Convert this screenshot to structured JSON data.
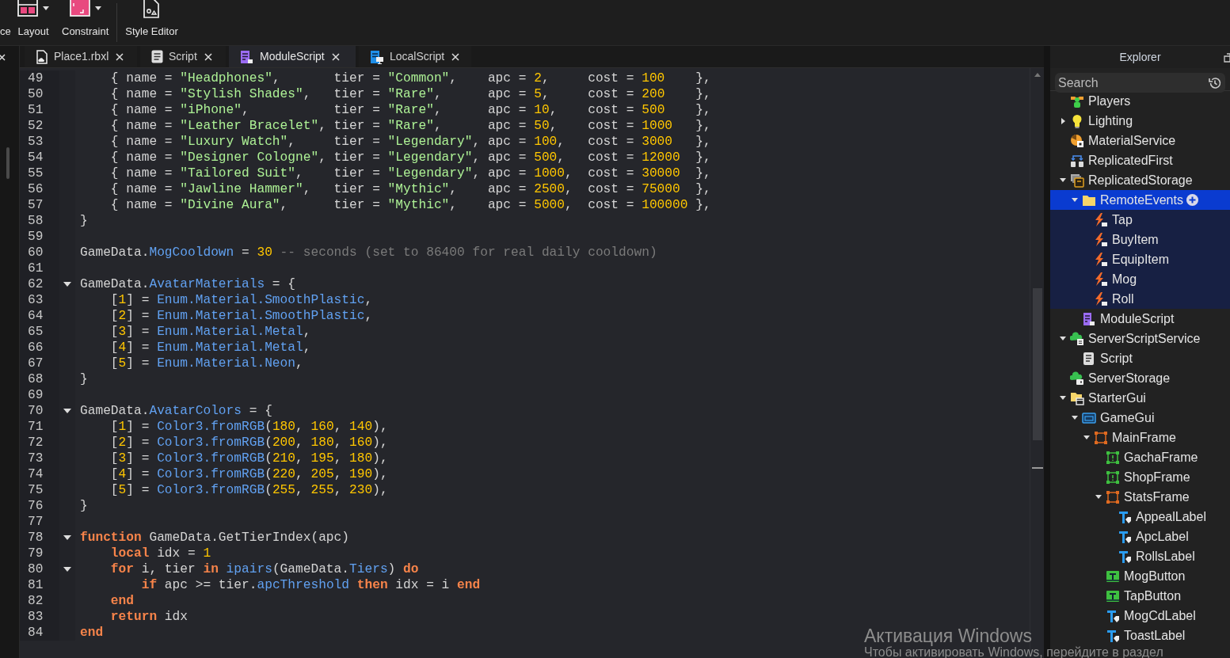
{
  "toolbar": [
    {
      "label": "ce",
      "kind": "cut",
      "dropdown": false
    },
    {
      "label": "Layout",
      "kind": "layout",
      "dropdown": true
    },
    {
      "label": "Constraint",
      "kind": "constraint",
      "dropdown": true
    },
    {
      "label": "Style Editor",
      "kind": "style-editor",
      "dropdown": false
    }
  ],
  "tabs": [
    {
      "label": "Place1.rbxl",
      "kind": "place",
      "selected": false
    },
    {
      "label": "Script",
      "kind": "script",
      "selected": false
    },
    {
      "label": "ModuleScript",
      "kind": "module",
      "selected": true
    },
    {
      "label": "LocalScript",
      "kind": "local",
      "selected": false
    }
  ],
  "editor": {
    "lines": [
      {
        "number": "49",
        "tokens": [
          {
            "text": "    { name = ",
            "kind": "plain"
          },
          {
            "text": "\"Headphones\"",
            "kind": "string"
          },
          {
            "text": ",       tier = ",
            "kind": "plain"
          },
          {
            "text": "\"Common\"",
            "kind": "string"
          },
          {
            "text": ",    apc = ",
            "kind": "plain"
          },
          {
            "text": "2",
            "kind": "number"
          },
          {
            "text": ",     cost = ",
            "kind": "plain"
          },
          {
            "text": "100",
            "kind": "number"
          },
          {
            "text": "    },",
            "kind": "plain"
          }
        ]
      },
      {
        "number": "50",
        "tokens": [
          {
            "text": "    { name = ",
            "kind": "plain"
          },
          {
            "text": "\"Stylish Shades\"",
            "kind": "string"
          },
          {
            "text": ",   tier = ",
            "kind": "plain"
          },
          {
            "text": "\"Rare\"",
            "kind": "string"
          },
          {
            "text": ",      apc = ",
            "kind": "plain"
          },
          {
            "text": "5",
            "kind": "number"
          },
          {
            "text": ",     cost = ",
            "kind": "plain"
          },
          {
            "text": "200",
            "kind": "number"
          },
          {
            "text": "    },",
            "kind": "plain"
          }
        ]
      },
      {
        "number": "51",
        "tokens": [
          {
            "text": "    { name = ",
            "kind": "plain"
          },
          {
            "text": "\"iPhone\"",
            "kind": "string"
          },
          {
            "text": ",           tier = ",
            "kind": "plain"
          },
          {
            "text": "\"Rare\"",
            "kind": "string"
          },
          {
            "text": ",      apc = ",
            "kind": "plain"
          },
          {
            "text": "10",
            "kind": "number"
          },
          {
            "text": ",    cost = ",
            "kind": "plain"
          },
          {
            "text": "500",
            "kind": "number"
          },
          {
            "text": "    },",
            "kind": "plain"
          }
        ]
      },
      {
        "number": "52",
        "tokens": [
          {
            "text": "    { name = ",
            "kind": "plain"
          },
          {
            "text": "\"Leather Bracelet\"",
            "kind": "string"
          },
          {
            "text": ", tier = ",
            "kind": "plain"
          },
          {
            "text": "\"Rare\"",
            "kind": "string"
          },
          {
            "text": ",      apc = ",
            "kind": "plain"
          },
          {
            "text": "50",
            "kind": "number"
          },
          {
            "text": ",    cost = ",
            "kind": "plain"
          },
          {
            "text": "1000",
            "kind": "number"
          },
          {
            "text": "   },",
            "kind": "plain"
          }
        ]
      },
      {
        "number": "53",
        "tokens": [
          {
            "text": "    { name = ",
            "kind": "plain"
          },
          {
            "text": "\"Luxury Watch\"",
            "kind": "string"
          },
          {
            "text": ",     tier = ",
            "kind": "plain"
          },
          {
            "text": "\"Legendary\"",
            "kind": "string"
          },
          {
            "text": ", apc = ",
            "kind": "plain"
          },
          {
            "text": "100",
            "kind": "number"
          },
          {
            "text": ",   cost = ",
            "kind": "plain"
          },
          {
            "text": "3000",
            "kind": "number"
          },
          {
            "text": "   },",
            "kind": "plain"
          }
        ]
      },
      {
        "number": "54",
        "tokens": [
          {
            "text": "    { name = ",
            "kind": "plain"
          },
          {
            "text": "\"Designer Cologne\"",
            "kind": "string"
          },
          {
            "text": ", tier = ",
            "kind": "plain"
          },
          {
            "text": "\"Legendary\"",
            "kind": "string"
          },
          {
            "text": ", apc = ",
            "kind": "plain"
          },
          {
            "text": "500",
            "kind": "number"
          },
          {
            "text": ",   cost = ",
            "kind": "plain"
          },
          {
            "text": "12000",
            "kind": "number"
          },
          {
            "text": "  },",
            "kind": "plain"
          }
        ]
      },
      {
        "number": "55",
        "tokens": [
          {
            "text": "    { name = ",
            "kind": "plain"
          },
          {
            "text": "\"Tailored Suit\"",
            "kind": "string"
          },
          {
            "text": ",    tier = ",
            "kind": "plain"
          },
          {
            "text": "\"Legendary\"",
            "kind": "string"
          },
          {
            "text": ", apc = ",
            "kind": "plain"
          },
          {
            "text": "1000",
            "kind": "number"
          },
          {
            "text": ",  cost = ",
            "kind": "plain"
          },
          {
            "text": "30000",
            "kind": "number"
          },
          {
            "text": "  },",
            "kind": "plain"
          }
        ]
      },
      {
        "number": "56",
        "tokens": [
          {
            "text": "    { name = ",
            "kind": "plain"
          },
          {
            "text": "\"Jawline Hammer\"",
            "kind": "string"
          },
          {
            "text": ",   tier = ",
            "kind": "plain"
          },
          {
            "text": "\"Mythic\"",
            "kind": "string"
          },
          {
            "text": ",    apc = ",
            "kind": "plain"
          },
          {
            "text": "2500",
            "kind": "number"
          },
          {
            "text": ",  cost = ",
            "kind": "plain"
          },
          {
            "text": "75000",
            "kind": "number"
          },
          {
            "text": "  },",
            "kind": "plain"
          }
        ]
      },
      {
        "number": "57",
        "tokens": [
          {
            "text": "    { name = ",
            "kind": "plain"
          },
          {
            "text": "\"Divine Aura\"",
            "kind": "string"
          },
          {
            "text": ",      tier = ",
            "kind": "plain"
          },
          {
            "text": "\"Mythic\"",
            "kind": "string"
          },
          {
            "text": ",    apc = ",
            "kind": "plain"
          },
          {
            "text": "5000",
            "kind": "number"
          },
          {
            "text": ",  cost = ",
            "kind": "plain"
          },
          {
            "text": "100000",
            "kind": "number"
          },
          {
            "text": " },",
            "kind": "plain"
          }
        ]
      },
      {
        "number": "58",
        "tokens": [
          {
            "text": "}",
            "kind": "plain"
          }
        ]
      },
      {
        "number": "59"
      },
      {
        "number": "60",
        "tokens": [
          {
            "text": "GameData.",
            "kind": "plain"
          },
          {
            "text": "MogCooldown",
            "kind": "member"
          },
          {
            "text": " = ",
            "kind": "plain"
          },
          {
            "text": "30",
            "kind": "number"
          },
          {
            "text": " -- seconds (set to 86400 for real daily cooldown)",
            "kind": "comment"
          }
        ]
      },
      {
        "number": "61"
      },
      {
        "number": "62",
        "fold": true,
        "tokens": [
          {
            "text": "GameData.",
            "kind": "plain"
          },
          {
            "text": "AvatarMaterials",
            "kind": "member"
          },
          {
            "text": " = {",
            "kind": "plain"
          }
        ]
      },
      {
        "number": "63",
        "tokens": [
          {
            "text": "    [",
            "kind": "plain"
          },
          {
            "text": "1",
            "kind": "number"
          },
          {
            "text": "] = ",
            "kind": "plain"
          },
          {
            "text": "Enum.Material.SmoothPlastic",
            "kind": "member"
          },
          {
            "text": ",",
            "kind": "plain"
          }
        ]
      },
      {
        "number": "64",
        "tokens": [
          {
            "text": "    [",
            "kind": "plain"
          },
          {
            "text": "2",
            "kind": "number"
          },
          {
            "text": "] = ",
            "kind": "plain"
          },
          {
            "text": "Enum.Material.SmoothPlastic",
            "kind": "member"
          },
          {
            "text": ",",
            "kind": "plain"
          }
        ]
      },
      {
        "number": "65",
        "tokens": [
          {
            "text": "    [",
            "kind": "plain"
          },
          {
            "text": "3",
            "kind": "number"
          },
          {
            "text": "] = ",
            "kind": "plain"
          },
          {
            "text": "Enum.Material.Metal",
            "kind": "member"
          },
          {
            "text": ",",
            "kind": "plain"
          }
        ]
      },
      {
        "number": "66",
        "tokens": [
          {
            "text": "    [",
            "kind": "plain"
          },
          {
            "text": "4",
            "kind": "number"
          },
          {
            "text": "] = ",
            "kind": "plain"
          },
          {
            "text": "Enum.Material.Metal",
            "kind": "member"
          },
          {
            "text": ",",
            "kind": "plain"
          }
        ]
      },
      {
        "number": "67",
        "tokens": [
          {
            "text": "    [",
            "kind": "plain"
          },
          {
            "text": "5",
            "kind": "number"
          },
          {
            "text": "] = ",
            "kind": "plain"
          },
          {
            "text": "Enum.Material.Neon",
            "kind": "member"
          },
          {
            "text": ",",
            "kind": "plain"
          }
        ]
      },
      {
        "number": "68",
        "tokens": [
          {
            "text": "}",
            "kind": "plain"
          }
        ]
      },
      {
        "number": "69"
      },
      {
        "number": "70",
        "fold": true,
        "tokens": [
          {
            "text": "GameData.",
            "kind": "plain"
          },
          {
            "text": "AvatarColors",
            "kind": "member"
          },
          {
            "text": " = {",
            "kind": "plain"
          }
        ]
      },
      {
        "number": "71",
        "tokens": [
          {
            "text": "    [",
            "kind": "plain"
          },
          {
            "text": "1",
            "kind": "number"
          },
          {
            "text": "] = ",
            "kind": "plain"
          },
          {
            "text": "Color3.fromRGB",
            "kind": "member"
          },
          {
            "text": "(",
            "kind": "plain"
          },
          {
            "text": "180",
            "kind": "number"
          },
          {
            "text": ", ",
            "kind": "plain"
          },
          {
            "text": "160",
            "kind": "number"
          },
          {
            "text": ", ",
            "kind": "plain"
          },
          {
            "text": "140",
            "kind": "number"
          },
          {
            "text": "),",
            "kind": "plain"
          }
        ]
      },
      {
        "number": "72",
        "tokens": [
          {
            "text": "    [",
            "kind": "plain"
          },
          {
            "text": "2",
            "kind": "number"
          },
          {
            "text": "] = ",
            "kind": "plain"
          },
          {
            "text": "Color3.fromRGB",
            "kind": "member"
          },
          {
            "text": "(",
            "kind": "plain"
          },
          {
            "text": "200",
            "kind": "number"
          },
          {
            "text": ", ",
            "kind": "plain"
          },
          {
            "text": "180",
            "kind": "number"
          },
          {
            "text": ", ",
            "kind": "plain"
          },
          {
            "text": "160",
            "kind": "number"
          },
          {
            "text": "),",
            "kind": "plain"
          }
        ]
      },
      {
        "number": "73",
        "tokens": [
          {
            "text": "    [",
            "kind": "plain"
          },
          {
            "text": "3",
            "kind": "number"
          },
          {
            "text": "] = ",
            "kind": "plain"
          },
          {
            "text": "Color3.fromRGB",
            "kind": "member"
          },
          {
            "text": "(",
            "kind": "plain"
          },
          {
            "text": "210",
            "kind": "number"
          },
          {
            "text": ", ",
            "kind": "plain"
          },
          {
            "text": "195",
            "kind": "number"
          },
          {
            "text": ", ",
            "kind": "plain"
          },
          {
            "text": "180",
            "kind": "number"
          },
          {
            "text": "),",
            "kind": "plain"
          }
        ]
      },
      {
        "number": "74",
        "tokens": [
          {
            "text": "    [",
            "kind": "plain"
          },
          {
            "text": "4",
            "kind": "number"
          },
          {
            "text": "] = ",
            "kind": "plain"
          },
          {
            "text": "Color3.fromRGB",
            "kind": "member"
          },
          {
            "text": "(",
            "kind": "plain"
          },
          {
            "text": "220",
            "kind": "number"
          },
          {
            "text": ", ",
            "kind": "plain"
          },
          {
            "text": "205",
            "kind": "number"
          },
          {
            "text": ", ",
            "kind": "plain"
          },
          {
            "text": "190",
            "kind": "number"
          },
          {
            "text": "),",
            "kind": "plain"
          }
        ]
      },
      {
        "number": "75",
        "tokens": [
          {
            "text": "    [",
            "kind": "plain"
          },
          {
            "text": "5",
            "kind": "number"
          },
          {
            "text": "] = ",
            "kind": "plain"
          },
          {
            "text": "Color3.fromRGB",
            "kind": "member"
          },
          {
            "text": "(",
            "kind": "plain"
          },
          {
            "text": "255",
            "kind": "number"
          },
          {
            "text": ", ",
            "kind": "plain"
          },
          {
            "text": "255",
            "kind": "number"
          },
          {
            "text": ", ",
            "kind": "plain"
          },
          {
            "text": "230",
            "kind": "number"
          },
          {
            "text": "),",
            "kind": "plain"
          }
        ]
      },
      {
        "number": "76",
        "tokens": [
          {
            "text": "}",
            "kind": "plain"
          }
        ]
      },
      {
        "number": "77"
      },
      {
        "number": "78",
        "fold": true,
        "tokens": [
          {
            "text": "function",
            "kind": "keyword"
          },
          {
            "text": " GameData.GetTierIndex(apc)",
            "kind": "plain"
          }
        ]
      },
      {
        "number": "79",
        "tokens": [
          {
            "text": "    local",
            "kind": "keyword"
          },
          {
            "text": " idx = ",
            "kind": "plain"
          },
          {
            "text": "1",
            "kind": "number"
          }
        ]
      },
      {
        "number": "80",
        "fold": true,
        "tokens": [
          {
            "text": "    for",
            "kind": "keyword"
          },
          {
            "text": " i, tier ",
            "kind": "plain"
          },
          {
            "text": "in",
            "kind": "keyword"
          },
          {
            "text": " ipairs",
            "kind": "member"
          },
          {
            "text": "(GameData.",
            "kind": "plain"
          },
          {
            "text": "Tiers",
            "kind": "member"
          },
          {
            "text": ") ",
            "kind": "plain"
          },
          {
            "text": "do",
            "kind": "keyword"
          }
        ]
      },
      {
        "number": "81",
        "tokens": [
          {
            "text": "        if",
            "kind": "keyword"
          },
          {
            "text": " apc >= tier.",
            "kind": "plain"
          },
          {
            "text": "apcThreshold",
            "kind": "member"
          },
          {
            "text": " then",
            "kind": "keyword"
          },
          {
            "text": " idx = i ",
            "kind": "plain"
          },
          {
            "text": "end",
            "kind": "keyword"
          }
        ]
      },
      {
        "number": "82",
        "tokens": [
          {
            "text": "    end",
            "kind": "keyword"
          }
        ]
      },
      {
        "number": "83",
        "tokens": [
          {
            "text": "    return",
            "kind": "keyword"
          },
          {
            "text": " idx",
            "kind": "plain"
          }
        ]
      },
      {
        "number": "84",
        "tokens": [
          {
            "text": "end",
            "kind": "keyword"
          }
        ]
      }
    ]
  },
  "explorer": {
    "title": "Explorer",
    "search": {
      "placeholder": "Search"
    },
    "items": [
      {
        "label": "Players",
        "kind": "players",
        "selected": false
      },
      {
        "label": "Lighting",
        "kind": "lighting",
        "selected": false,
        "expanded": false
      },
      {
        "label": "MaterialService",
        "kind": "material",
        "selected": false
      },
      {
        "label": "ReplicatedFirst",
        "kind": "replicated-first",
        "selected": false
      },
      {
        "label": "ReplicatedStorage",
        "kind": "storage",
        "selected": false,
        "expanded": true,
        "children": [
          {
            "label": "RemoteEvents",
            "kind": "folder",
            "selected": true,
            "expanded": true,
            "children": [
              {
                "label": "Tap",
                "kind": "remote-event",
                "selected": false
              },
              {
                "label": "BuyItem",
                "kind": "remote-event",
                "selected": false
              },
              {
                "label": "EquipItem",
                "kind": "remote-event",
                "selected": false
              },
              {
                "label": "Mog",
                "kind": "remote-event",
                "selected": false
              },
              {
                "label": "Roll",
                "kind": "remote-event",
                "selected": false
              }
            ]
          },
          {
            "label": "ModuleScript",
            "kind": "module",
            "selected": false
          }
        ]
      },
      {
        "label": "ServerScriptService",
        "kind": "script-service",
        "selected": false,
        "expanded": true,
        "children": [
          {
            "label": "Script",
            "kind": "script",
            "selected": false
          }
        ]
      },
      {
        "label": "ServerStorage",
        "kind": "server-storage",
        "selected": false
      },
      {
        "label": "StarterGui",
        "kind": "starter-gui",
        "selected": false,
        "expanded": true,
        "children": [
          {
            "label": "GameGui",
            "kind": "screen-gui",
            "selected": false,
            "expanded": true,
            "children": [
              {
                "label": "MainFrame",
                "kind": "frame",
                "selected": false,
                "expanded": true,
                "children": [
                  {
                    "label": "GachaFrame",
                    "kind": "frame-alt",
                    "selected": false
                  },
                  {
                    "label": "ShopFrame",
                    "kind": "frame-alt",
                    "selected": false
                  },
                  {
                    "label": "StatsFrame",
                    "kind": "frame",
                    "selected": false,
                    "expanded": true,
                    "children": [
                      {
                        "label": "AppealLabel",
                        "kind": "text-label",
                        "selected": false
                      },
                      {
                        "label": "ApcLabel",
                        "kind": "text-label",
                        "selected": false
                      },
                      {
                        "label": "RollsLabel",
                        "kind": "text-label",
                        "selected": false
                      }
                    ]
                  },
                  {
                    "label": "MogButton",
                    "kind": "text-button",
                    "selected": false
                  },
                  {
                    "label": "TapButton",
                    "kind": "text-button",
                    "selected": false
                  },
                  {
                    "label": "MogCdLabel",
                    "kind": "text-label",
                    "selected": false
                  },
                  {
                    "label": "ToastLabel",
                    "kind": "text-label",
                    "selected": false
                  }
                ]
              }
            ]
          }
        ]
      }
    ]
  },
  "activation_notice": {
    "title": "Активация Windows",
    "message": "Чтобы активировать Windows, перейдите в раздел"
  }
}
